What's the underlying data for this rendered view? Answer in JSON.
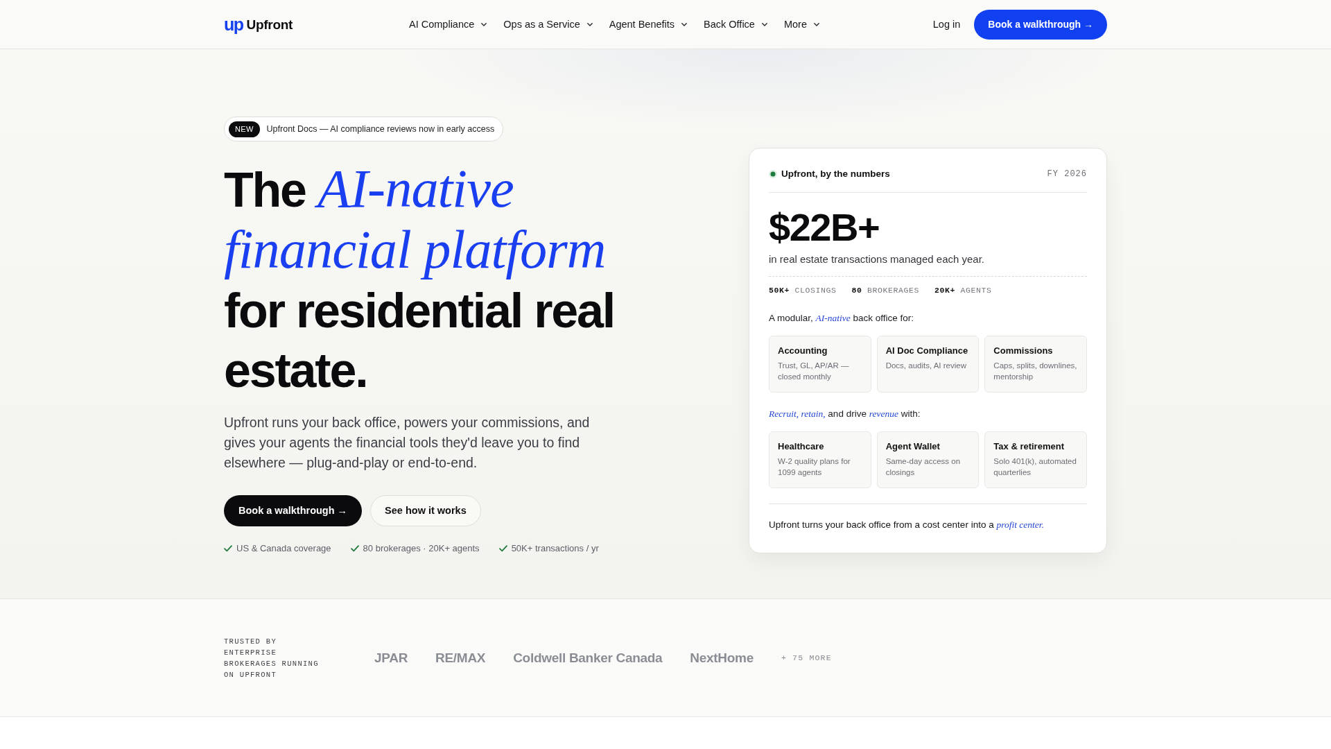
{
  "header": {
    "logo": {
      "mark": "up",
      "name": "Upfront"
    },
    "nav": [
      {
        "label": "AI Compliance",
        "dropdown": true
      },
      {
        "label": "Ops as a Service",
        "dropdown": true
      },
      {
        "label": "Agent Benefits",
        "dropdown": true
      },
      {
        "label": "Back Office",
        "dropdown": true
      },
      {
        "label": "More",
        "dropdown": true
      }
    ],
    "login": "Log in",
    "cta": "Book a walkthrough →"
  },
  "hero": {
    "announcement": {
      "badge": "NEW",
      "text": "Upfront Docs — AI compliance reviews now in early access"
    },
    "headline": "The *AI-native financial platform* for residential real estate.",
    "intro": "Upfront runs your back office, powers your commissions, and gives your agents the financial tools they'd leave you to find elsewhere — plug-and-play or end-to-end.",
    "buttons": [
      {
        "label": "Book a walkthrough →",
        "kind": "primary"
      },
      {
        "label": "See how it works",
        "kind": "secondary"
      }
    ],
    "highlights": [
      "US & Canada coverage",
      "80 brokerages · 20K+ agents",
      "50K+ transactions / yr"
    ]
  },
  "numbers_card": {
    "title": "Upfront, by the numbers",
    "period": "FY 2026",
    "value": "$22B+",
    "caption": "in real estate transactions managed each year.",
    "stats": [
      {
        "value": "50K+",
        "label": "CLOSINGS"
      },
      {
        "value": "80",
        "label": "BROKERAGES"
      },
      {
        "value": "20K+",
        "label": "AGENTS"
      }
    ],
    "groups": [
      {
        "intro": "A modular, *AI-native* back office for:",
        "tiles": [
          {
            "title": "Accounting",
            "description": "Trust, GL, AP/AR — closed monthly"
          },
          {
            "title": "AI Doc Compliance",
            "description": "Docs, audits, AI review"
          },
          {
            "title": "Commissions",
            "description": "Caps, splits, downlines, mentorship"
          }
        ]
      },
      {
        "intro": "*Recruit, retain,* and drive *revenue* with:",
        "tiles": [
          {
            "title": "Healthcare",
            "description": "W-2 quality plans for 1099 agents"
          },
          {
            "title": "Agent Wallet",
            "description": "Same-day access on closings"
          },
          {
            "title": "Tax & retirement",
            "description": "Solo 401(k), automated quarterlies"
          }
        ]
      }
    ],
    "footer": "Upfront turns your back office from a cost center into a *profit center.*"
  },
  "trust_strip": {
    "label": "TRUSTED BY ENTERPRISE BROKERAGES RUNNING ON UPFRONT",
    "brands": [
      "JPAR",
      "RE/MAX",
      "Coldwell Banker Canada",
      "NextHome"
    ],
    "more": "+ 75 MORE"
  }
}
